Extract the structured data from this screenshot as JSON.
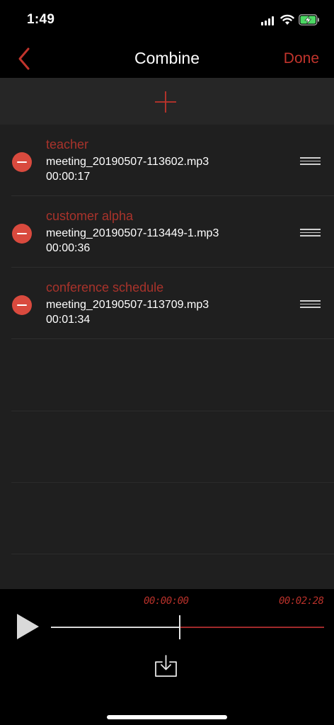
{
  "status_bar": {
    "time": "1:49"
  },
  "nav": {
    "title": "Combine",
    "done_label": "Done"
  },
  "items": [
    {
      "title": "teacher",
      "file": "meeting_20190507-113602.mp3",
      "duration": "00:00:17"
    },
    {
      "title": "customer alpha",
      "file": "meeting_20190507-113449-1.mp3",
      "duration": "00:00:36"
    },
    {
      "title": "conference schedule",
      "file": "meeting_20190507-113709.mp3",
      "duration": "00:01:34"
    }
  ],
  "player": {
    "current_time": "00:00:00",
    "total_time": "00:02:28",
    "progress_fraction": 0.47
  },
  "colors": {
    "accent": "#c1342c",
    "delete": "#d94a3e",
    "list_background": "#1f1f1f",
    "add_row_background": "#262626"
  },
  "icons": {
    "back": "chevron-left-icon",
    "add": "plus-icon",
    "delete": "minus-circle-icon",
    "reorder": "reorder-icon",
    "play": "play-icon",
    "share": "share-icon"
  }
}
